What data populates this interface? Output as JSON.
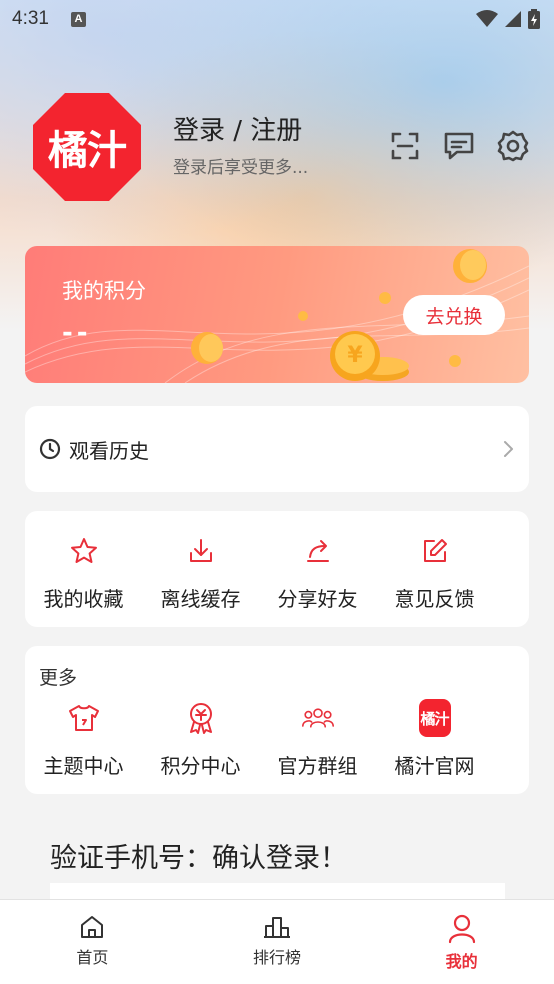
{
  "status_bar": {
    "time": "4:31",
    "notification_letter": "A"
  },
  "profile": {
    "avatar_text": "橘汁",
    "login_title": "登录 / 注册",
    "login_subtitle": "登录后享受更多..."
  },
  "points": {
    "title": "我的积分",
    "value": "--",
    "redeem_label": "去兑换"
  },
  "history": {
    "label": "观看历史"
  },
  "actions": [
    {
      "label": "我的收藏",
      "icon": "star-icon"
    },
    {
      "label": "离线缓存",
      "icon": "download-icon"
    },
    {
      "label": "分享好友",
      "icon": "share-icon"
    },
    {
      "label": "意见反馈",
      "icon": "edit-icon"
    }
  ],
  "more": {
    "title": "更多",
    "items": [
      {
        "label": "主题中心",
        "icon": "tshirt-icon"
      },
      {
        "label": "积分中心",
        "icon": "medal-icon"
      },
      {
        "label": "官方群组",
        "icon": "group-icon"
      },
      {
        "label": "橘汁官网",
        "icon": "logo-icon",
        "logo_text": "橘汁"
      }
    ]
  },
  "verify": {
    "text": "验证手机号：确认登录！"
  },
  "tabs": [
    {
      "label": "首页",
      "active": false
    },
    {
      "label": "排行榜",
      "active": false
    },
    {
      "label": "我的",
      "active": true
    }
  ],
  "colors": {
    "accent": "#e8303a",
    "avatar_bg": "#f3242f"
  }
}
